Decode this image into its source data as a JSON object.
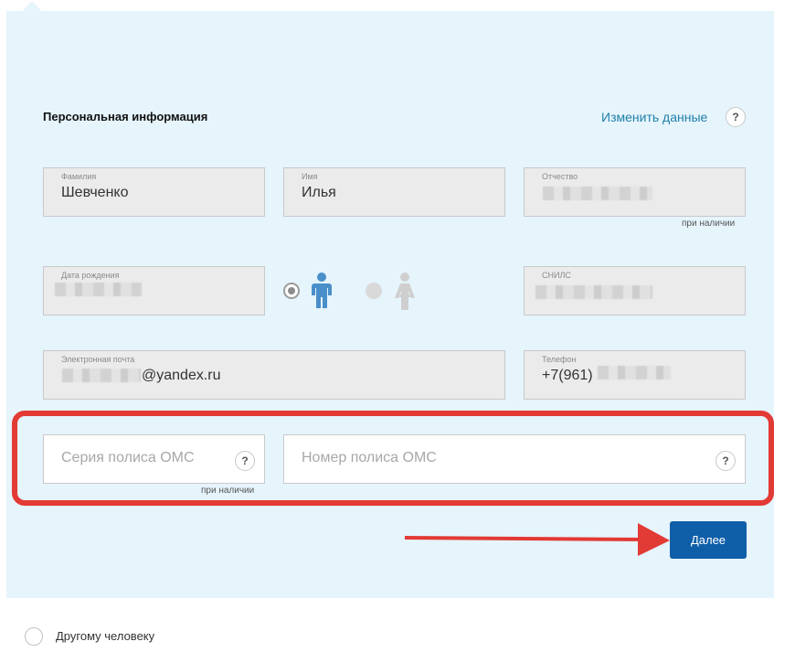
{
  "section": {
    "title": "Персональная информация",
    "edit_link": "Изменить данные",
    "help_glyph": "?"
  },
  "fields": {
    "last_name": {
      "label": "Фамилия",
      "value": "Шевченко"
    },
    "first_name": {
      "label": "Имя",
      "value": "Илья"
    },
    "patronymic": {
      "label": "Отчество",
      "value": "",
      "note": "при наличии"
    },
    "birth_date": {
      "label": "Дата рождения",
      "value": ""
    },
    "snils": {
      "label": "СНИЛС",
      "value": ""
    },
    "email": {
      "label": "Электронная почта",
      "value_suffix": "@yandex.ru"
    },
    "phone": {
      "label": "Телефон",
      "value_prefix": "+7(961)"
    }
  },
  "gender": {
    "selected": "male",
    "male_icon": "male-person-icon",
    "female_icon": "female-person-icon",
    "male_color": "#4a8fc9",
    "female_color": "#cfcfcf"
  },
  "oms": {
    "series_placeholder": "Серия полиса ОМС",
    "series_note": "при наличии",
    "number_placeholder": "Номер полиса ОМС"
  },
  "actions": {
    "next_label": "Далее",
    "other_person_label": "Другому человеку"
  },
  "colors": {
    "panel_bg": "#e6f4fc",
    "link": "#1f7fa8",
    "primary_button": "#0f5ea8",
    "highlight": "#e23a34"
  }
}
